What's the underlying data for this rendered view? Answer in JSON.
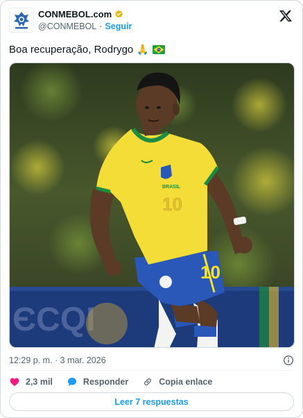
{
  "author": {
    "display_name": "CONMEBOL.com",
    "handle": "@CONMEBOL",
    "separator": "·",
    "follow_label": "Seguir",
    "avatar_icon": "conmebol-logo-icon",
    "verified_icon": "verified-gold-badge-icon",
    "verified_color": "#e2b719"
  },
  "platform_icon": "x-logo-icon",
  "tweet": {
    "text": "Boa recuperação, Rodrygo",
    "emoji_1": "🙏",
    "emoji_2_icon": "brazil-flag-icon"
  },
  "media": {
    "image_icon": "player-photo",
    "jersey_number": "10",
    "jersey_text": "BRASIL"
  },
  "meta": {
    "timestamp": "12:29 p. m. · 3 mar. 2026",
    "info_icon": "info-icon"
  },
  "actions": {
    "like_count": "2,3 mil",
    "like_icon": "heart-icon",
    "like_color": "#f91880",
    "reply_label": "Responder",
    "reply_icon": "speech-bubble-icon",
    "reply_color": "#1d9bf0",
    "copy_label": "Copia enlace",
    "copy_icon": "link-icon"
  },
  "replies_button": {
    "label": "Leer 7 respuestas"
  },
  "colors": {
    "accent": "#1d9bf0",
    "text": "#0f1419",
    "muted": "#536471",
    "border": "#cfd9de"
  }
}
